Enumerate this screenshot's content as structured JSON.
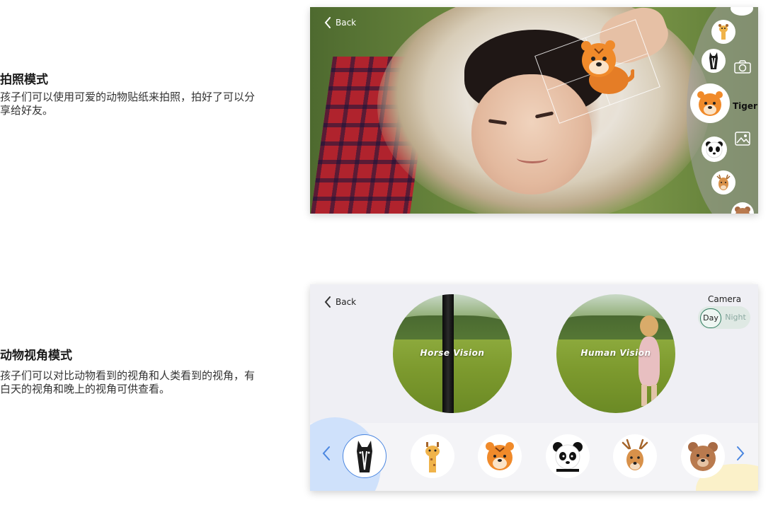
{
  "section1": {
    "title": "拍照模式",
    "desc": "孩子们可以使用可爱的动物贴纸来拍照，拍好了可以分享给好友。"
  },
  "section2": {
    "title": "动物视角模式",
    "desc": "孩子们可以对比动物看到的视角和人类看到的视角，有白天的视角和晚上的视角可供查看。"
  },
  "screen1": {
    "back_label": "Back",
    "selected_animal_label": "Tiger",
    "animals": [
      "giraffe-icon",
      "horse-icon",
      "tiger-icon",
      "panda-icon",
      "deer-icon",
      "bear-icon"
    ],
    "side_icons": [
      "camera-icon",
      "gallery-icon"
    ]
  },
  "screen2": {
    "back_label": "Back",
    "left_vision_label": "Horse Vision",
    "right_vision_label": "Human Vision",
    "camera_label": "Camera",
    "mode_day": "Day",
    "mode_night": "Night",
    "selected_mode": "Day",
    "animals": [
      "horse-icon",
      "giraffe-icon",
      "tiger-icon",
      "panda-icon",
      "deer-icon",
      "bear-icon"
    ],
    "selected_animal": "horse-icon",
    "accent_color": "#4a86e0"
  }
}
